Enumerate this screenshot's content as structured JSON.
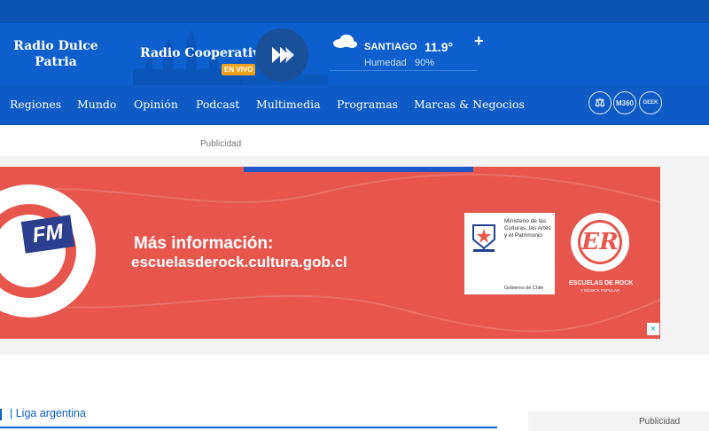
{
  "header": {
    "station_left": "Radio Dulce Patria",
    "station_main": "Radio Cooperativa",
    "live_badge": "EN VIVO",
    "play_icon": "fast-forward-play-icon"
  },
  "weather": {
    "city": "SANTIAGO",
    "temperature": "11.9°",
    "humidity_label": "Humedad",
    "humidity_value": "90%",
    "icon": "cloud-icon",
    "more": "+"
  },
  "nav": {
    "items": [
      "Regiones",
      "Mundo",
      "Opinión",
      "Podcast",
      "Multimedia",
      "Programas",
      "Marcas & Negocios"
    ],
    "icons": [
      {
        "name": "justice-icon",
        "label": "⚖"
      },
      {
        "name": "m360-icon",
        "label": "M360"
      },
      {
        "name": "geek-icon",
        "label": "GEEK"
      }
    ]
  },
  "ads": {
    "top_label": "Publicidad",
    "fm_text": "FM",
    "line1": "Más información:",
    "line2": "escuelasderock.cultura.gob.cl",
    "gob_text": "Ministerio de las Culturas, las Artes y el Patrimonio",
    "gob_footer": "Gobierno de Chile",
    "er_letters": "ER",
    "er_label": "ESCUELAS DE ROCK",
    "er_sub": "Y MÚSICA POPULAR",
    "close": "×",
    "side_label": "Publicidad"
  },
  "breadcrumb": {
    "label": "| Liga argentina"
  },
  "colors": {
    "header_blue": "#0c5fcd",
    "nav_blue": "#0e5bc7",
    "live_orange": "#f2a11a",
    "ad_red": "#e6564c"
  }
}
